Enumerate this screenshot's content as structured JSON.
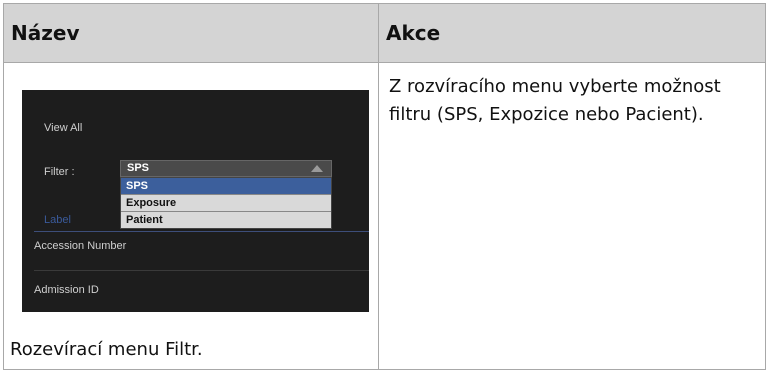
{
  "table": {
    "header_name": "Název",
    "header_action": "Akce"
  },
  "row": {
    "caption": "Rozevírací menu Filtr.",
    "action_text": "Z rozvíracího menu vyberte možnost filtru (SPS, Expozice nebo Pacient)."
  },
  "screenshot": {
    "view_all": "View All",
    "filter_label": "Filter :",
    "filter_value": "SPS",
    "options": [
      "SPS",
      "Exposure",
      "Patient"
    ],
    "selected_option": "SPS",
    "label_text": "Label",
    "accession_label": "Accession Number",
    "admission_label": "Admission ID"
  }
}
